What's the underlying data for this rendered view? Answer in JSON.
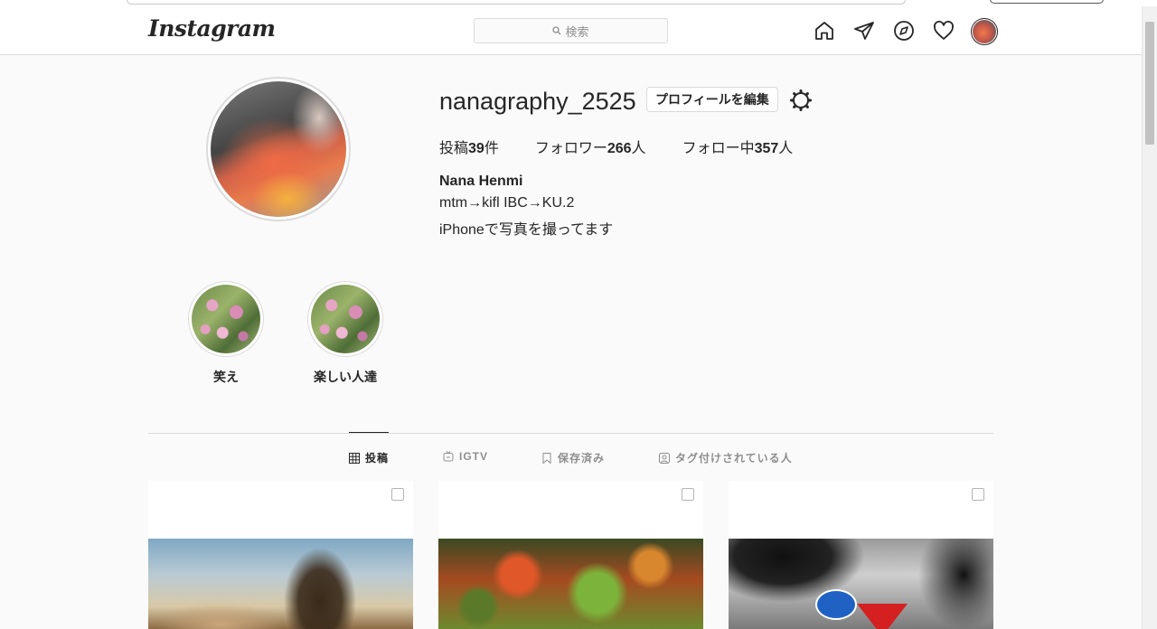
{
  "header": {
    "logo": "Instagram",
    "search": {
      "placeholder": "検索",
      "icon": "search-icon"
    },
    "nav": [
      "home-icon",
      "direct-message-icon",
      "explore-icon",
      "activity-heart-icon",
      "profile-avatar"
    ]
  },
  "profile": {
    "username": "nanagraphy_2525",
    "edit_button": "プロフィールを編集",
    "settings_icon": "gear-icon",
    "stats": {
      "posts_prefix": "投稿",
      "posts_count": "39",
      "posts_suffix": "件",
      "followers_prefix": "フォロワー",
      "followers_count": "266",
      "followers_suffix": "人",
      "following_prefix": "フォロー中",
      "following_count": "357",
      "following_suffix": "人"
    },
    "full_name": "Nana Henmi",
    "bio_lines": [
      "mtm→kifl IBC→KU.2",
      "iPhoneで写真を撮ってます"
    ]
  },
  "highlights": [
    {
      "label": "笑え"
    },
    {
      "label": "楽しい人達"
    }
  ],
  "tabs": [
    {
      "label": "投稿",
      "icon": "grid-icon",
      "active": true
    },
    {
      "label": "IGTV",
      "icon": "igtv-icon",
      "active": false
    },
    {
      "label": "保存済み",
      "icon": "bookmark-icon",
      "active": false
    },
    {
      "label": "タグ付けされている人",
      "icon": "tagged-icon",
      "active": false
    }
  ],
  "posts": [
    {
      "subject": "tree-silhouette-sky"
    },
    {
      "subject": "autumn-foliage"
    },
    {
      "subject": "road-signs"
    }
  ],
  "colors": {
    "background": "#fafafa",
    "text": "#262626",
    "muted": "#8e8e8e",
    "border": "#dbdbdb"
  }
}
